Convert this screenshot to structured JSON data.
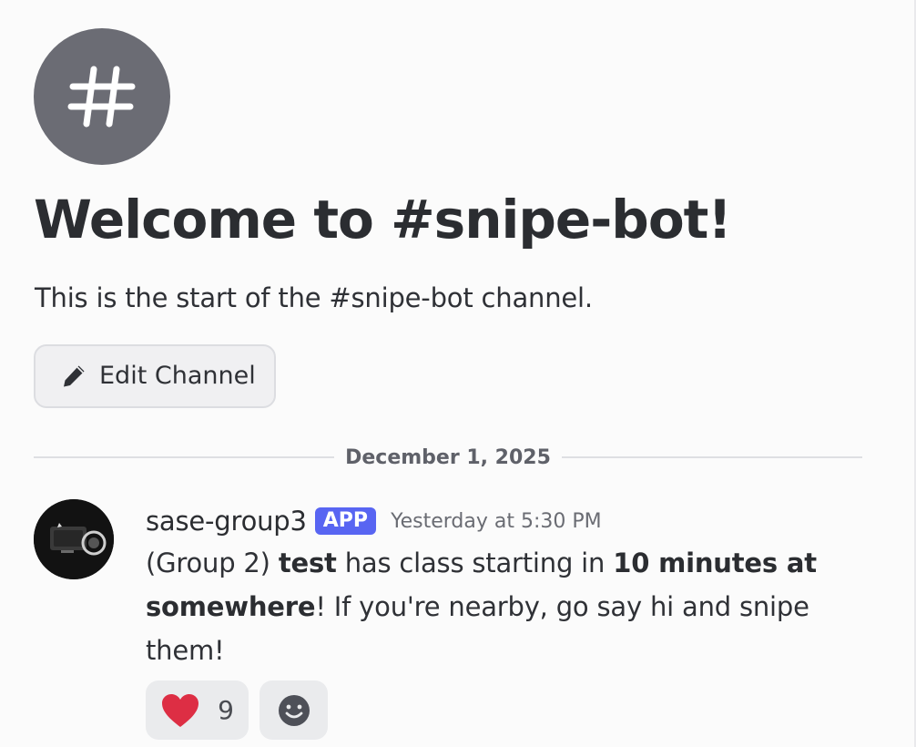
{
  "channel": {
    "icon": "hash-icon",
    "welcome_title": "Welcome to #snipe-bot!",
    "intro_text": "This is the start of the #snipe-bot channel.",
    "edit_button_label": "Edit Channel",
    "edit_icon": "pencil-icon"
  },
  "divider": {
    "date": "December 1, 2025"
  },
  "message": {
    "username": "sase-group3",
    "badge": "APP",
    "timestamp": "Yesterday at 5:30 PM",
    "body_parts": {
      "p1": "(Group 2) ",
      "b1": "test",
      "p2": " has class starting in ",
      "b2": "10 minutes at somewhere",
      "p3": "! If you're nearby, go say hi and snipe them!"
    },
    "reactions": [
      {
        "emoji": "heart-icon",
        "count": "9"
      },
      {
        "emoji": "add-reaction-icon"
      }
    ]
  },
  "colors": {
    "accent": "#5865f2",
    "heart": "#dd2e44",
    "background": "#fbfbfb"
  }
}
